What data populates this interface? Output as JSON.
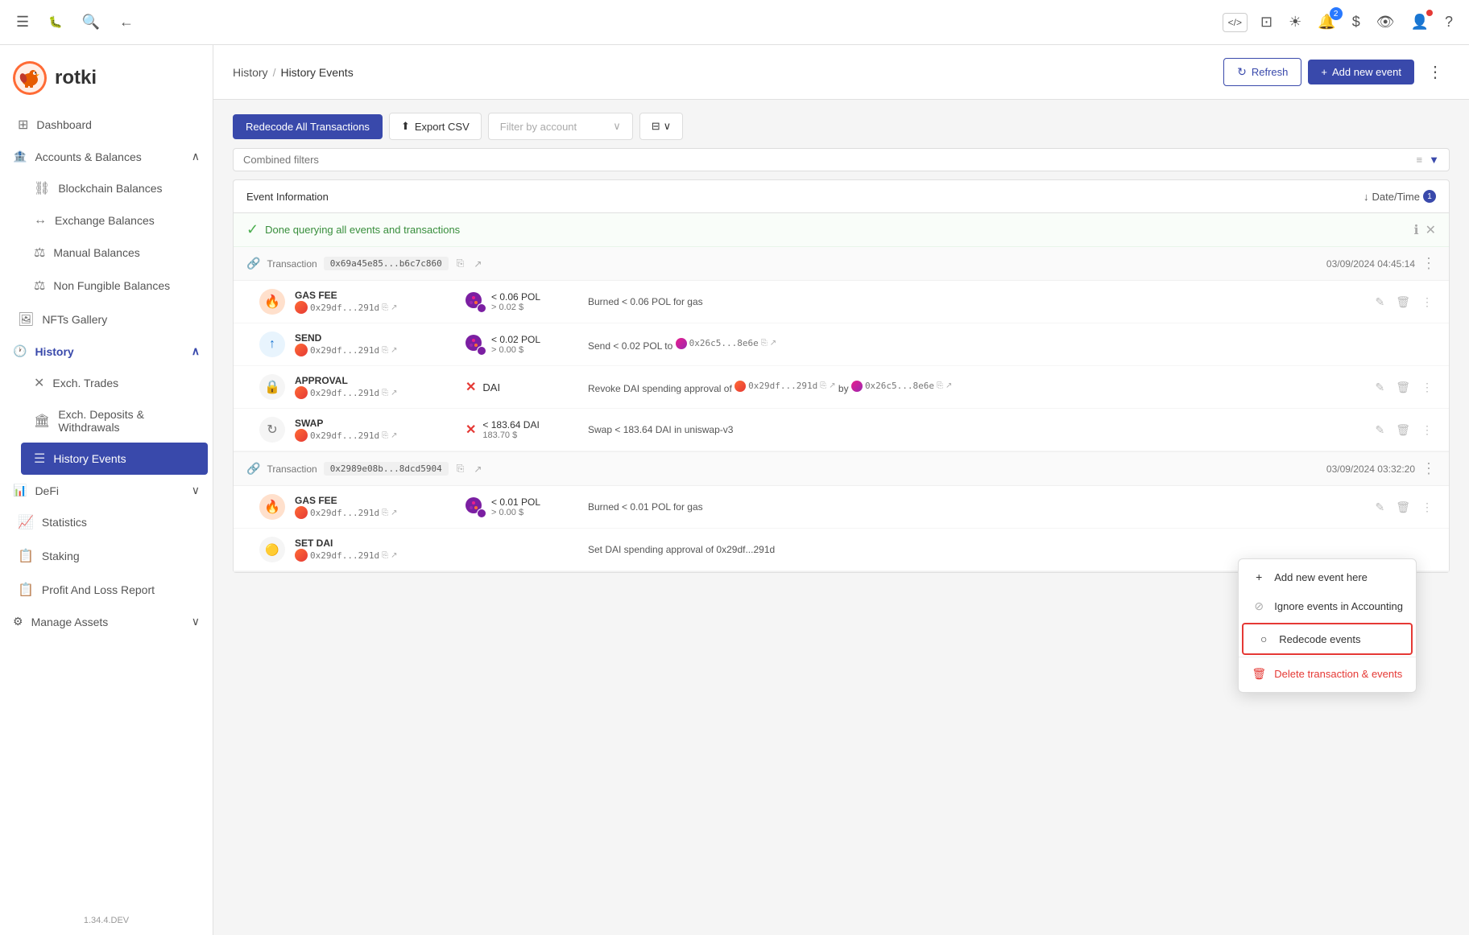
{
  "app": {
    "version": "1.34.4.DEV",
    "logo_text": "rotki"
  },
  "topbar": {
    "menu_icon": "☰",
    "bug_icon": "🐛",
    "search_icon": "🔍",
    "back_icon": "←",
    "code_icon": "</>",
    "layout_icon": "⊡",
    "theme_icon": "☀",
    "bell_icon": "🔔",
    "bell_badge": "2",
    "dollar_icon": "$",
    "eye_icon": "👁",
    "user_icon": "👤",
    "help_icon": "?"
  },
  "sidebar": {
    "items": [
      {
        "id": "dashboard",
        "label": "Dashboard",
        "icon": "⊞",
        "active": false
      },
      {
        "id": "accounts-balances",
        "label": "Accounts & Balances",
        "icon": "🏦",
        "active": false,
        "expandable": true,
        "expanded": true
      },
      {
        "id": "blockchain-balances",
        "label": "Blockchain Balances",
        "icon": "⛓",
        "active": false,
        "sub": true
      },
      {
        "id": "exchange-balances",
        "label": "Exchange Balances",
        "icon": "↔",
        "active": false,
        "sub": true
      },
      {
        "id": "manual-balances",
        "label": "Manual Balances",
        "icon": "⚖",
        "active": false,
        "sub": true
      },
      {
        "id": "non-fungible-balances",
        "label": "Non Fungible Balances",
        "icon": "⚖",
        "active": false,
        "sub": true
      },
      {
        "id": "nfts-gallery",
        "label": "NFTs Gallery",
        "icon": "🖼",
        "active": false
      },
      {
        "id": "history",
        "label": "History",
        "icon": "🕐",
        "active": true,
        "expandable": true,
        "expanded": true
      },
      {
        "id": "exch-trades",
        "label": "Exch. Trades",
        "icon": "✕",
        "active": false,
        "sub": true
      },
      {
        "id": "exch-deposits",
        "label": "Exch. Deposits & Withdrawals",
        "icon": "🏛",
        "active": false,
        "sub": true
      },
      {
        "id": "history-events",
        "label": "History Events",
        "icon": "☰",
        "active": true,
        "sub": true
      },
      {
        "id": "defi",
        "label": "DeFi",
        "icon": "📊",
        "active": false,
        "expandable": true,
        "expanded": false
      },
      {
        "id": "statistics",
        "label": "Statistics",
        "icon": "📈",
        "active": false
      },
      {
        "id": "staking",
        "label": "Staking",
        "icon": "📋",
        "active": false
      },
      {
        "id": "profit-loss",
        "label": "Profit And Loss Report",
        "icon": "📋",
        "active": false
      },
      {
        "id": "manage-assets",
        "label": "Manage Assets",
        "icon": "⚙",
        "active": false,
        "expandable": true,
        "expanded": false
      }
    ]
  },
  "page": {
    "breadcrumb_parent": "History",
    "breadcrumb_current": "History Events",
    "refresh_label": "Refresh",
    "add_new_label": "Add new event"
  },
  "toolbar": {
    "redecode_label": "Redecode All Transactions",
    "export_label": "Export CSV",
    "filter_placeholder": "Filter by account",
    "combined_filters_placeholder": "Combined filters"
  },
  "table": {
    "col_event": "Event Information",
    "col_datetime": "Date/Time",
    "sort_badge": "1",
    "status_msg": "Done querying all events and transactions",
    "transactions": [
      {
        "id": "tx1",
        "type": "Transaction",
        "hash": "0x69a45e85...b6c7c860",
        "datetime": "03/09/2024 04:45:14",
        "events": [
          {
            "id": "ev1",
            "event_type": "GAS FEE",
            "addr": "0x29df...291d",
            "asset_amount": "< 0.06 POL",
            "asset_value": "> 0.02 $",
            "description": "Burned < 0.06 POL for gas",
            "icon_color": "#ff6b35",
            "has_chain": true
          },
          {
            "id": "ev2",
            "event_type": "SEND",
            "addr": "0x29df...291d",
            "asset_amount": "< 0.02 POL",
            "asset_value": "> 0.00 $",
            "description": "Send < 0.02 POL to 0x26c5...8e6e",
            "icon_color": "#ff6b35",
            "has_chain": true,
            "has_dest": true,
            "dest_addr": "0x26c5...8e6e"
          },
          {
            "id": "ev3",
            "event_type": "APPROVAL",
            "addr": "0x29df...291d",
            "asset_symbol": "DAI",
            "asset_amount": "",
            "asset_value": "",
            "description": "Revoke DAI spending approval of 0x29df...291d by 0x26c5...8e6e",
            "icon_color": "#ff6b35",
            "has_chain": false,
            "is_x": true
          },
          {
            "id": "ev4",
            "event_type": "SWAP",
            "addr": "0x29df...291d",
            "asset_amount": "< 183.64 DAI",
            "asset_value": "183.70 $",
            "description": "Swap < 183.64 DAI in uniswap-v3",
            "icon_color": "#ff6b35",
            "has_chain": false,
            "is_x": true
          }
        ]
      },
      {
        "id": "tx2",
        "type": "Transaction",
        "hash": "0x2989e08b...8dcd5904",
        "datetime": "03/09/2024 03:32:20",
        "events": [
          {
            "id": "ev5",
            "event_type": "GAS FEE",
            "addr": "0x29df...291d",
            "asset_amount": "< 0.01 POL",
            "asset_value": "> 0.00 $",
            "description": "Burned < 0.01 POL for gas",
            "icon_color": "#ff6b35",
            "has_chain": true
          },
          {
            "id": "ev6",
            "event_type": "SET DAI",
            "addr": "0x29df...291d",
            "asset_amount": "",
            "asset_value": "",
            "description": "Set DAI spending approval of 0x29df...291d",
            "icon_color": "#ff6b35",
            "has_chain": true
          }
        ]
      }
    ]
  },
  "context_menu": {
    "items": [
      {
        "id": "add-event",
        "label": "Add new event here",
        "icon": "+",
        "danger": false
      },
      {
        "id": "ignore-accounting",
        "label": "Ignore events in Accounting",
        "icon": "◌",
        "danger": false
      },
      {
        "id": "redecode",
        "label": "Redecode events",
        "icon": "○",
        "danger": false,
        "highlighted": true
      },
      {
        "id": "delete",
        "label": "Delete transaction & events",
        "icon": "🗑",
        "danger": true
      }
    ]
  }
}
